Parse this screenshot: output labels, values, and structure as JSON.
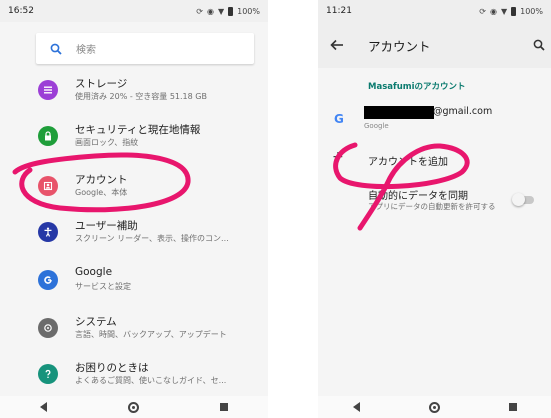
{
  "left": {
    "status": {
      "time": "16:52",
      "battery": "100%"
    },
    "search": {
      "placeholder": "検索"
    },
    "items": [
      {
        "title": "ストレージ",
        "subtitle": "使用済み 20% - 空き容量 51.18 GB",
        "icon": "storage-icon",
        "color": "#9c3fd6"
      },
      {
        "title": "セキュリティと現在地情報",
        "subtitle": "画面ロック、指紋",
        "icon": "lock-icon",
        "color": "#1f9e3a"
      },
      {
        "title": "アカウント",
        "subtitle": "Google、本体",
        "icon": "account-icon",
        "color": "#e8536a"
      },
      {
        "title": "ユーザー補助",
        "subtitle": "スクリーン リーダー、表示、操作のコン...",
        "icon": "accessibility-icon",
        "color": "#2638a6"
      },
      {
        "title": "Google",
        "subtitle": "サービスと設定",
        "icon": "google-icon",
        "color": "#2d72d9"
      },
      {
        "title": "システム",
        "subtitle": "言語、時間、バックアップ、アップデート",
        "icon": "info-icon",
        "color": "#6b6b6b"
      },
      {
        "title": "お困りのときは",
        "subtitle": "よくあるご質問、使いこなしガイド、セ...",
        "icon": "help-icon",
        "color": "#17937c"
      }
    ]
  },
  "right": {
    "status": {
      "time": "11:21",
      "battery": "100%"
    },
    "appbar": {
      "title": "アカウント"
    },
    "section_header": "Masafumiのアカウント",
    "account": {
      "email_suffix": "@gmail.com",
      "type": "Google"
    },
    "add_account": {
      "label": "アカウントを追加"
    },
    "sync": {
      "title": "自動的にデータを同期",
      "subtitle": "アプリにデータの自動更新を許可する"
    }
  },
  "colors": {
    "annotation": "#e8166d",
    "accent": "#0a7a6e"
  }
}
